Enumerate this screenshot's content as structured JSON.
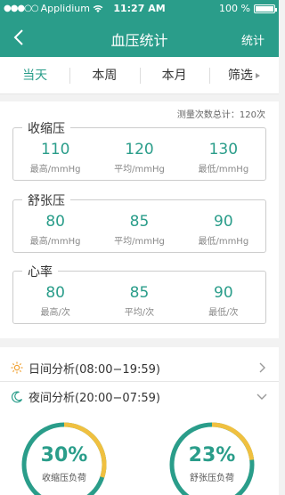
{
  "status": {
    "carrier": "Applidium",
    "time": "11:27 AM",
    "battery": "100 %"
  },
  "nav": {
    "title": "血压统计",
    "right_label": "统计"
  },
  "tabs": [
    "当天",
    "本周",
    "本月",
    "筛选"
  ],
  "summary": {
    "total_label": "测量次数总计：120次",
    "groups": [
      {
        "label": "收缩压",
        "values": [
          "110",
          "120",
          "130"
        ],
        "units": [
          "最高/mmHg",
          "平均/mmHg",
          "最低/mmHg"
        ]
      },
      {
        "label": "舒张压",
        "values": [
          "80",
          "85",
          "90"
        ],
        "units": [
          "最高/mmHg",
          "平均/mmHg",
          "最低/mmHg"
        ]
      },
      {
        "label": "心率",
        "values": [
          "80",
          "85",
          "90"
        ],
        "units": [
          "最高/次",
          "平均/次",
          "最低/次"
        ]
      }
    ]
  },
  "analysis": {
    "day": "日间分析(08:00−19:59)",
    "night": "夜间分析(20:00−07:59)",
    "rings": [
      {
        "percent": "30%",
        "label": "收缩压负荷",
        "fraction": 0.3
      },
      {
        "percent": "23%",
        "label": "舒张压负荷",
        "fraction": 0.23
      }
    ]
  },
  "colors": {
    "primary": "#2a9d8a",
    "ring_accent": "#f0c040",
    "background": "#f2f2f2"
  }
}
